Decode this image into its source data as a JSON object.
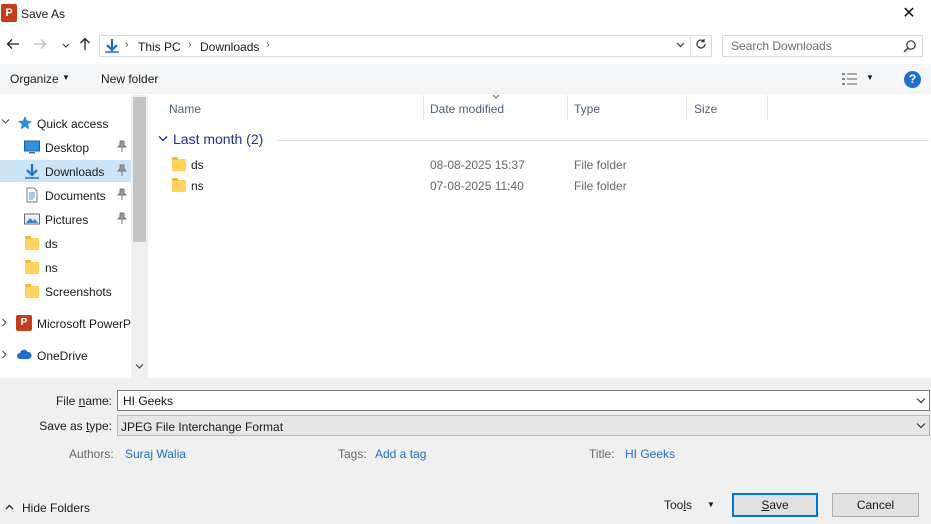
{
  "window": {
    "title": "Save As",
    "app_icon_letter": "P",
    "close_glyph": "✕"
  },
  "address_bar": {
    "crumbs": [
      "This PC",
      "Downloads"
    ],
    "search_placeholder": "Search Downloads"
  },
  "toolbar": {
    "organize_label": "Organize",
    "new_folder_label": "New folder",
    "help_glyph": "?"
  },
  "nav_pane": {
    "quick_access": "Quick access",
    "items": [
      {
        "label": "Desktop",
        "icon": "desktop-icon",
        "pinned": true
      },
      {
        "label": "Downloads",
        "icon": "downloads-icon",
        "pinned": true,
        "selected": true
      },
      {
        "label": "Documents",
        "icon": "documents-icon",
        "pinned": true
      },
      {
        "label": "Pictures",
        "icon": "pictures-icon",
        "pinned": true
      },
      {
        "label": "ds",
        "icon": "folder-icon"
      },
      {
        "label": "ns",
        "icon": "folder-icon"
      },
      {
        "label": "Screenshots",
        "icon": "folder-icon"
      }
    ],
    "microsoft_powerpoint": "Microsoft PowerP",
    "onedrive": "OneDrive"
  },
  "columns": {
    "name": "Name",
    "date_modified": "Date modified",
    "type": "Type",
    "size": "Size"
  },
  "group": {
    "label": "Last month (2)"
  },
  "files": [
    {
      "name": "ds",
      "date": "08-08-2025 15:37",
      "type": "File folder"
    },
    {
      "name": "ns",
      "date": "07-08-2025 11:40",
      "type": "File folder"
    }
  ],
  "form": {
    "file_name_label_pre": "File ",
    "file_name_label_u": "n",
    "file_name_label_post": "ame:",
    "file_name_value": "HI Geeks",
    "save_type_label_pre": "Save as ",
    "save_type_label_u": "t",
    "save_type_label_post": "ype:",
    "save_type_value": "JPEG File Interchange Format",
    "authors_label": "Authors:",
    "authors_value": "Suraj Walia",
    "tags_label": "Tags:",
    "tags_value": "Add a tag",
    "title_label": "Title:",
    "title_value": "HI Geeks"
  },
  "footer": {
    "hide_folders": "Hide Folders",
    "tools_pre": "Too",
    "tools_u": "l",
    "tools_post": "s",
    "save_u": "S",
    "save_post": "ave",
    "cancel": "Cancel"
  },
  "colors": {
    "accent": "#0078d7",
    "selection": "#cce4f7",
    "link": "#1e6fc9",
    "group_header": "#1e3287"
  }
}
